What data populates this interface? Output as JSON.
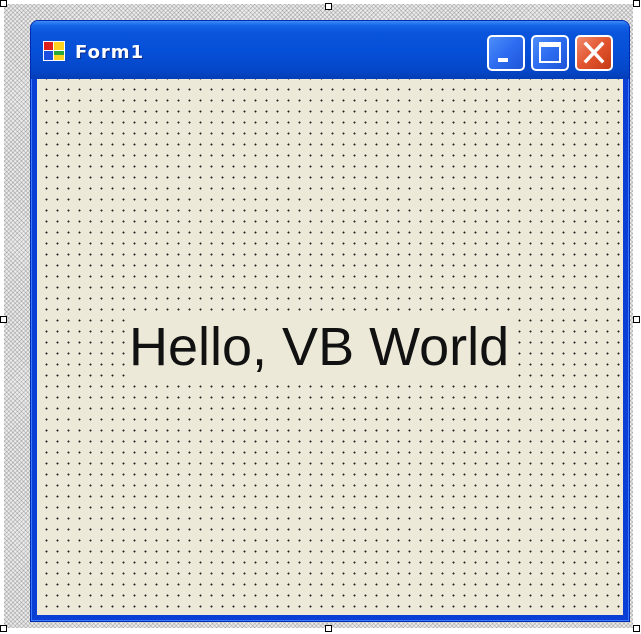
{
  "form": {
    "title": "Form1",
    "label_text": "Hello, VB World"
  },
  "icons": {
    "app": "form-app-icon",
    "minimize": "minimize-icon",
    "maximize": "maximize-icon",
    "close": "close-icon"
  },
  "colors": {
    "titlebar": "#0650d9",
    "client_background": "#ece9d8",
    "close_button": "#e2552f",
    "caption_button": "#2d6cf0"
  }
}
